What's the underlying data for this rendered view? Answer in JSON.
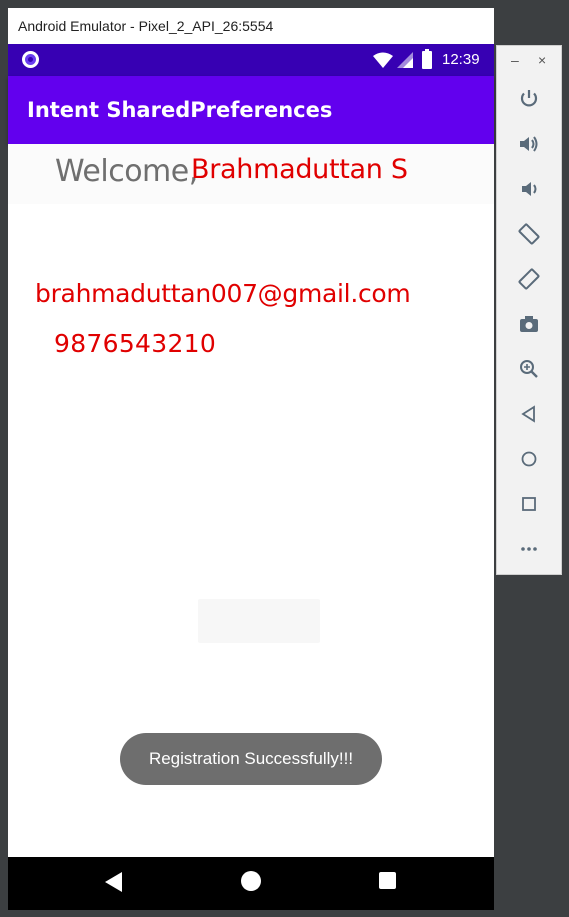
{
  "window": {
    "title": "Android Emulator - Pixel_2_API_26:5554"
  },
  "status_bar": {
    "time": "12:39",
    "icons": [
      "notification-dot-icon",
      "wifi-icon",
      "signal-icon",
      "battery-icon"
    ]
  },
  "app_bar": {
    "title": "Intent SharedPreferences"
  },
  "profile": {
    "welcome_label": "Welcome,",
    "name": "Brahmaduttan S",
    "email": "brahmaduttan007@gmail.com",
    "phone": "9876543210"
  },
  "toast": {
    "message": "Registration Successfully!!!"
  },
  "nav_bar": {
    "icons": [
      "back-icon",
      "home-icon",
      "recents-icon"
    ]
  },
  "emulator_panel": {
    "window_controls": {
      "minimize": "–",
      "close": "×"
    },
    "buttons": [
      "power-icon",
      "volume-up-icon",
      "volume-down-icon",
      "rotate-left-icon",
      "rotate-right-icon",
      "camera-icon",
      "zoom-icon",
      "back-icon",
      "home-icon",
      "overview-icon",
      "more-icon"
    ]
  },
  "colors": {
    "primary": "#6200ee",
    "primary_dark": "#3700b3",
    "accent_text": "#e00000",
    "toast_bg": "#6e6e6e"
  }
}
